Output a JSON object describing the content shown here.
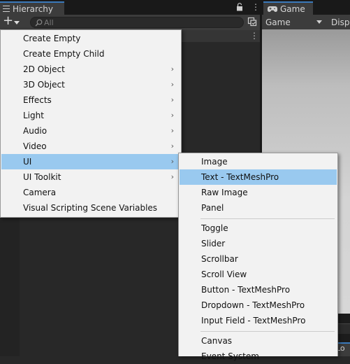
{
  "hierarchy": {
    "tab_title": "Hierarchy",
    "more_glyph": "⋮",
    "add_glyph": "+",
    "search": {
      "placeholder": "All",
      "value": ""
    }
  },
  "game": {
    "tab_title": "Game",
    "view_dropdown": "Game",
    "display_dropdown": "Disp",
    "console_tab_partial": "Lo"
  },
  "context_menu": {
    "arrow_glyph": "›",
    "items": [
      {
        "label": "Create Empty",
        "submenu": false
      },
      {
        "label": "Create Empty Child",
        "submenu": false
      },
      {
        "label": "2D Object",
        "submenu": true
      },
      {
        "label": "3D Object",
        "submenu": true
      },
      {
        "label": "Effects",
        "submenu": true
      },
      {
        "label": "Light",
        "submenu": true
      },
      {
        "label": "Audio",
        "submenu": true
      },
      {
        "label": "Video",
        "submenu": true
      },
      {
        "label": "UI",
        "submenu": true,
        "active": true
      },
      {
        "label": "UI Toolkit",
        "submenu": true
      },
      {
        "label": "Camera",
        "submenu": false
      },
      {
        "label": "Visual Scripting Scene Variables",
        "submenu": false
      }
    ]
  },
  "ui_submenu": {
    "items": [
      {
        "label": "Image"
      },
      {
        "label": "Text - TextMeshPro",
        "highlighted": true
      },
      {
        "label": "Raw Image"
      },
      {
        "label": "Panel"
      },
      {
        "label": "Toggle"
      },
      {
        "label": "Slider"
      },
      {
        "label": "Scrollbar"
      },
      {
        "label": "Scroll View"
      },
      {
        "label": "Button - TextMeshPro"
      },
      {
        "label": "Dropdown - TextMeshPro"
      },
      {
        "label": "Input Field - TextMeshPro"
      },
      {
        "label": "Canvas"
      },
      {
        "label": "Event System"
      }
    ]
  },
  "colors": {
    "highlight": "#99c9ef",
    "menu_background": "#f2f2f2",
    "active_tab_accent": "#3a79bb",
    "panel_background": "#282828"
  }
}
